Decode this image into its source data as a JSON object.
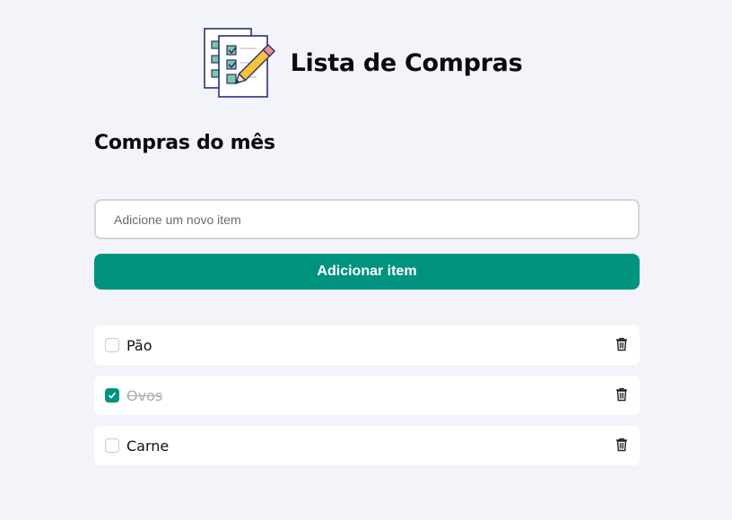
{
  "header": {
    "title": "Lista de Compras",
    "logo_icon": "checklist-pencil-icon"
  },
  "section": {
    "title": "Compras do mês"
  },
  "new_item": {
    "placeholder": "Adicione um novo item",
    "value": ""
  },
  "add_button": {
    "label": "Adicionar item"
  },
  "colors": {
    "background": "#f3f4f9",
    "accent": "#00937f",
    "done_text": "#a9abb2"
  },
  "items": [
    {
      "label": "Pão",
      "checked": false
    },
    {
      "label": "Ovos",
      "checked": true
    },
    {
      "label": "Carne",
      "checked": false
    }
  ]
}
